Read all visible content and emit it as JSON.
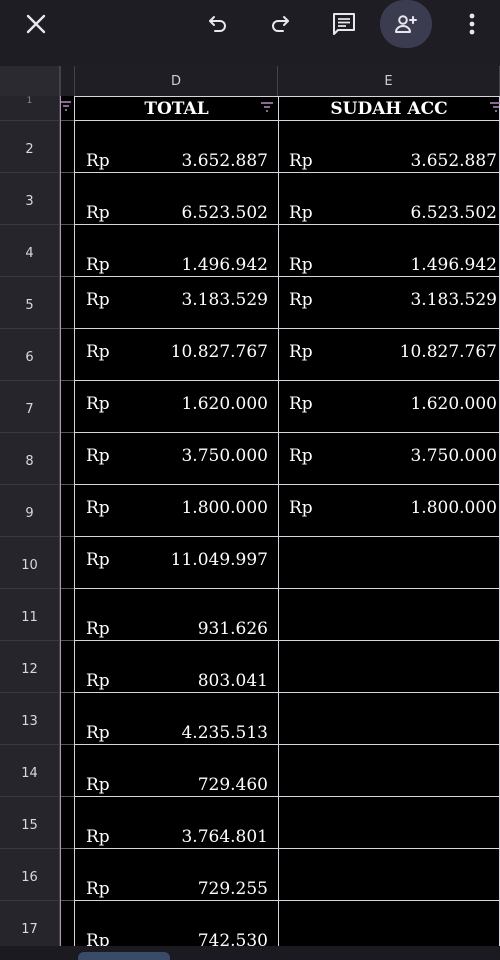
{
  "toolbar": {
    "icons": [
      "close-icon",
      "undo-icon",
      "redo-icon",
      "comment-icon",
      "add-person-icon",
      "more-vertical-icon"
    ]
  },
  "columns": {
    "d": "D",
    "e": "E"
  },
  "header_row": {
    "number": "1",
    "total": "TOTAL",
    "sudah_acc": "SUDAH ACC"
  },
  "rows": [
    {
      "number": "2",
      "total_cur": "Rp",
      "total": "3.652.887",
      "acc_cur": "Rp",
      "acc": "3.652.887"
    },
    {
      "number": "3",
      "total_cur": "Rp",
      "total": "6.523.502",
      "acc_cur": "Rp",
      "acc": "6.523.502"
    },
    {
      "number": "4",
      "total_cur": "Rp",
      "total": "1.496.942",
      "acc_cur": "Rp",
      "acc": "1.496.942"
    },
    {
      "number": "5",
      "total_cur": "Rp",
      "total": "3.183.529",
      "acc_cur": "Rp",
      "acc": "3.183.529"
    },
    {
      "number": "6",
      "total_cur": "Rp",
      "total": "10.827.767",
      "acc_cur": "Rp",
      "acc": "10.827.767"
    },
    {
      "number": "7",
      "total_cur": "Rp",
      "total": "1.620.000",
      "acc_cur": "Rp",
      "acc": "1.620.000"
    },
    {
      "number": "8",
      "total_cur": "Rp",
      "total": "3.750.000",
      "acc_cur": "Rp",
      "acc": "3.750.000"
    },
    {
      "number": "9",
      "total_cur": "Rp",
      "total": "1.800.000",
      "acc_cur": "Rp",
      "acc": "1.800.000"
    },
    {
      "number": "10",
      "total_cur": "Rp",
      "total": "11.049.997",
      "acc_cur": "",
      "acc": ""
    },
    {
      "number": "11",
      "total_cur": "Rp",
      "total": "931.626",
      "acc_cur": "",
      "acc": ""
    },
    {
      "number": "12",
      "total_cur": "Rp",
      "total": "803.041",
      "acc_cur": "",
      "acc": ""
    },
    {
      "number": "13",
      "total_cur": "Rp",
      "total": "4.235.513",
      "acc_cur": "",
      "acc": ""
    },
    {
      "number": "14",
      "total_cur": "Rp",
      "total": "729.460",
      "acc_cur": "",
      "acc": ""
    },
    {
      "number": "15",
      "total_cur": "Rp",
      "total": "3.764.801",
      "acc_cur": "",
      "acc": ""
    },
    {
      "number": "16",
      "total_cur": "Rp",
      "total": "729.255",
      "acc_cur": "",
      "acc": ""
    },
    {
      "number": "17",
      "total_cur": "Rp",
      "total": "742.530",
      "acc_cur": "",
      "acc": ""
    }
  ],
  "colors": {
    "accent": "#b58fc0",
    "cell_bg": "#000000",
    "grid_line": "#d7d3df"
  }
}
